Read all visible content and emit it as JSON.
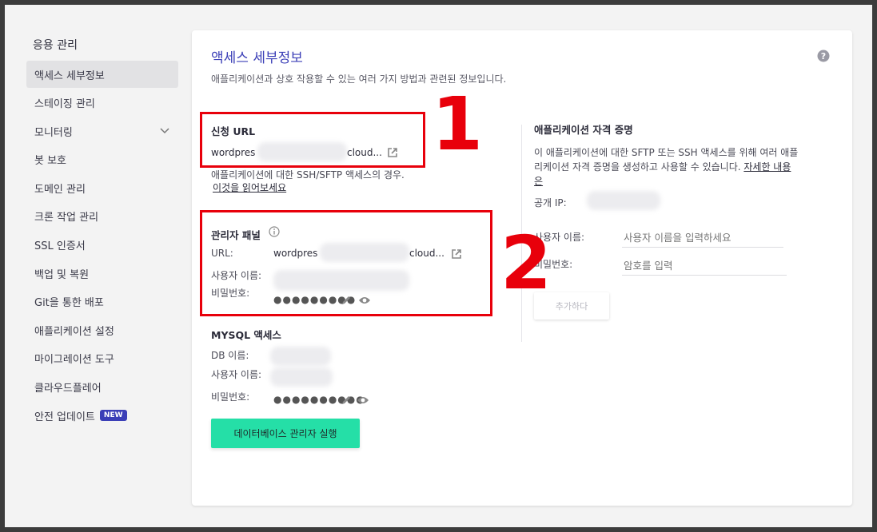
{
  "sidebar": {
    "title": "응용 관리",
    "items": [
      {
        "label": "액세스 세부정보"
      },
      {
        "label": "스테이징 관리"
      },
      {
        "label": "모니터링"
      },
      {
        "label": "봇 보호"
      },
      {
        "label": "도메인 관리"
      },
      {
        "label": "크론 작업 관리"
      },
      {
        "label": "SSL 인증서"
      },
      {
        "label": "백업 및 복원"
      },
      {
        "label": "Git을 통한 배포"
      },
      {
        "label": "애플리케이션 설정"
      },
      {
        "label": "마이그레이션 도구"
      },
      {
        "label": "클라우드플레어"
      },
      {
        "label": "안전 업데이트",
        "badge": "NEW"
      }
    ]
  },
  "main": {
    "title": "액세스 세부정보",
    "subtitle": "애플리케이션과 상호 작용할 수 있는 여러 가지 방법과 관련된 정보입니다.",
    "app_url": {
      "heading": "신청 URL",
      "value_start": "wordpres",
      "value_end": "cloud...",
      "note": "애플리케이션에 대한 SSH/SFTP 액세스의 경우.",
      "note_link": "이것을 읽어보세요"
    },
    "admin_panel": {
      "heading": "관리자 패널",
      "url_label": "URL:",
      "url_start": "wordpres",
      "url_end": "cloud...",
      "user_label": "사용자 이름:",
      "password_label": "비밀번호:",
      "password_mask": "●●●●●●●●●"
    },
    "mysql": {
      "heading": "MYSQL 액세스",
      "db_label": "DB 이름:",
      "user_label": "사용자 이름:",
      "password_label": "비밀번호:",
      "password_mask": "●●●●●●●●●●",
      "db_button": "데이터베이스 관리자 실행"
    },
    "credentials": {
      "heading": "애플리케이션 자격 증명",
      "description": "이 애플리케이션에 대한 SFTP 또는 SSH 액세스를 위해 여러 애플리케이션 자격 증명을 생성하고 사용할 수 있습니다.",
      "description_line1": "이 애플리케이션에 대한 SFTP 또는 SSH 액세스를 위해 여러 애플",
      "description_line2": "리케이션 자격 증명을 생성하고 사용할 수 있습니다.",
      "link_line1": "자세한 내용",
      "link_line2": "은",
      "public_ip_label": "공개 IP:",
      "username_label": "사용자 이름:",
      "username_placeholder": "사용자 이름을 입력하세요",
      "password_label": "비밀번호:",
      "password_placeholder": "암호를 입력",
      "add_button": "추가하다"
    }
  },
  "annotations": {
    "one": "1",
    "two": "2",
    "color": "#e8000b"
  },
  "colors": {
    "accent": "#3b3fb7",
    "db_button": "#25dfa7",
    "badge": "#3b3fb7"
  }
}
